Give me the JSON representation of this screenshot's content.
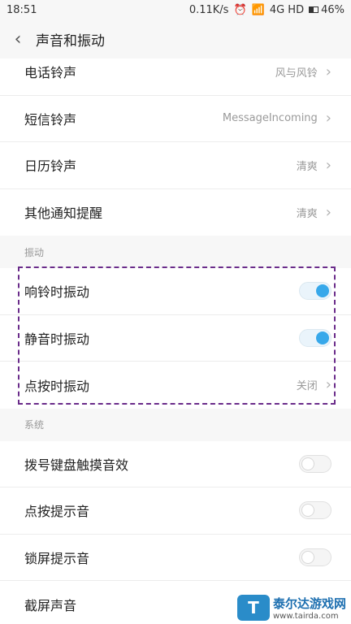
{
  "status": {
    "time": "18:51",
    "speed": "0.11K/s",
    "network": "4G HD",
    "battery": "46%",
    "battery_level": 0.46
  },
  "header": {
    "back_glyph": "‹",
    "title": "声音和振动"
  },
  "ringtones": [
    {
      "label": "电话铃声",
      "value": "风与风铃"
    },
    {
      "label": "短信铃声",
      "value": "MessageIncoming"
    },
    {
      "label": "日历铃声",
      "value": "清爽"
    },
    {
      "label": "其他通知提醒",
      "value": "清爽"
    }
  ],
  "vibration": {
    "header": "振动",
    "ring_label": "响铃时振动",
    "ring_on": true,
    "silent_label": "静音时振动",
    "silent_on": true,
    "touch_label": "点按时振动",
    "touch_value": "关闭"
  },
  "system": {
    "header": "系统",
    "dial_label": "拨号键盘触摸音效",
    "dial_on": false,
    "tap_label": "点按提示音",
    "tap_on": false,
    "lock_label": "锁屏提示音",
    "lock_on": false,
    "screenshot_label": "截屏声音"
  },
  "watermark": {
    "title": "泰尔达游戏网",
    "url": "www.tairda.com"
  },
  "colors": {
    "accent": "#37a8ea",
    "highlight_border": "#6a2c8a"
  },
  "chevron": "›"
}
